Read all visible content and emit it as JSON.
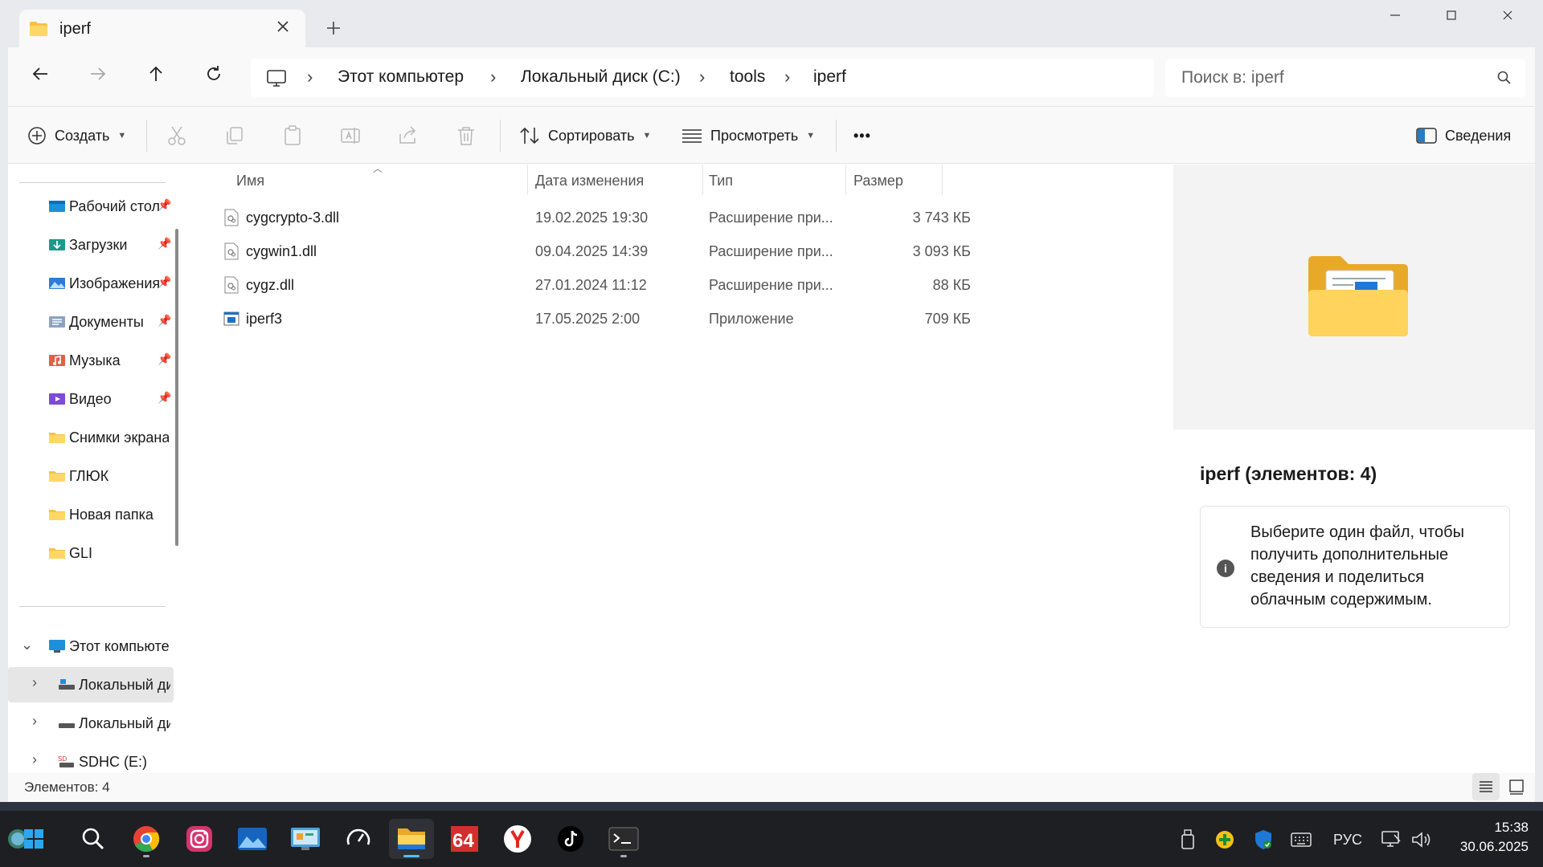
{
  "window": {
    "tab_title": "iperf",
    "minimize": "—",
    "maximize": "☐",
    "close": "✕"
  },
  "navigation": {
    "breadcrumbs": [
      "Этот компьютер",
      "Локальный диск (C:)",
      "tools",
      "iperf"
    ],
    "search_placeholder": "Поиск в: iperf"
  },
  "toolbar": {
    "create_label": "Создать",
    "sort_label": "Сортировать",
    "view_label": "Просмотреть",
    "more_label": "•••",
    "details_label": "Сведения"
  },
  "sidebar": {
    "quick_access": [
      {
        "label": "Рабочий стол",
        "icon": "desktop-icon",
        "pinned": true
      },
      {
        "label": "Загрузки",
        "icon": "downloads-icon",
        "pinned": true
      },
      {
        "label": "Изображения",
        "icon": "pictures-icon",
        "pinned": true
      },
      {
        "label": "Документы",
        "icon": "documents-icon",
        "pinned": true
      },
      {
        "label": "Музыка",
        "icon": "music-icon",
        "pinned": true
      },
      {
        "label": "Видео",
        "icon": "videos-icon",
        "pinned": true
      },
      {
        "label": "Снимки экрана",
        "icon": "folder-icon",
        "pinned": false
      },
      {
        "label": "ГЛЮК",
        "icon": "folder-icon",
        "pinned": false
      },
      {
        "label": "Новая папка",
        "icon": "folder-icon",
        "pinned": false
      },
      {
        "label": "GLI",
        "icon": "folder-icon",
        "pinned": false
      }
    ],
    "this_pc": "Этот компьютер",
    "drives": [
      {
        "label": "Локальный диск (C:)",
        "active": true
      },
      {
        "label": "Локальный диск (D:)",
        "active": false
      },
      {
        "label": "SDHC (E:)",
        "active": false
      }
    ]
  },
  "filelist": {
    "columns": {
      "name": "Имя",
      "date": "Дата изменения",
      "type": "Тип",
      "size": "Размер"
    },
    "rows": [
      {
        "name": "cygcrypto-3.dll",
        "date": "19.02.2025 19:30",
        "type": "Расширение при...",
        "size": "3 743 КБ",
        "icon": "dll-file-icon"
      },
      {
        "name": "cygwin1.dll",
        "date": "09.04.2025 14:39",
        "type": "Расширение при...",
        "size": "3 093 КБ",
        "icon": "dll-file-icon"
      },
      {
        "name": "cygz.dll",
        "date": "27.01.2024 11:12",
        "type": "Расширение при...",
        "size": "88 КБ",
        "icon": "dll-file-icon"
      },
      {
        "name": "iperf3",
        "date": "17.05.2025 2:00",
        "type": "Приложение",
        "size": "709 КБ",
        "icon": "exe-file-icon"
      }
    ]
  },
  "details": {
    "title": "iperf (элементов: 4)",
    "info": "Выберите один файл, чтобы получить дополнительные сведения и поделиться облачным содержимым."
  },
  "statusbar": {
    "count": "Элементов: 4"
  },
  "taskbar": {
    "language": "РУС",
    "time": "15:38",
    "date": "30.06.2025"
  },
  "colors": {
    "accent": "#0067c0",
    "folder_yellow": "#f6c244",
    "taskbar_bg": "#1e1f22"
  }
}
